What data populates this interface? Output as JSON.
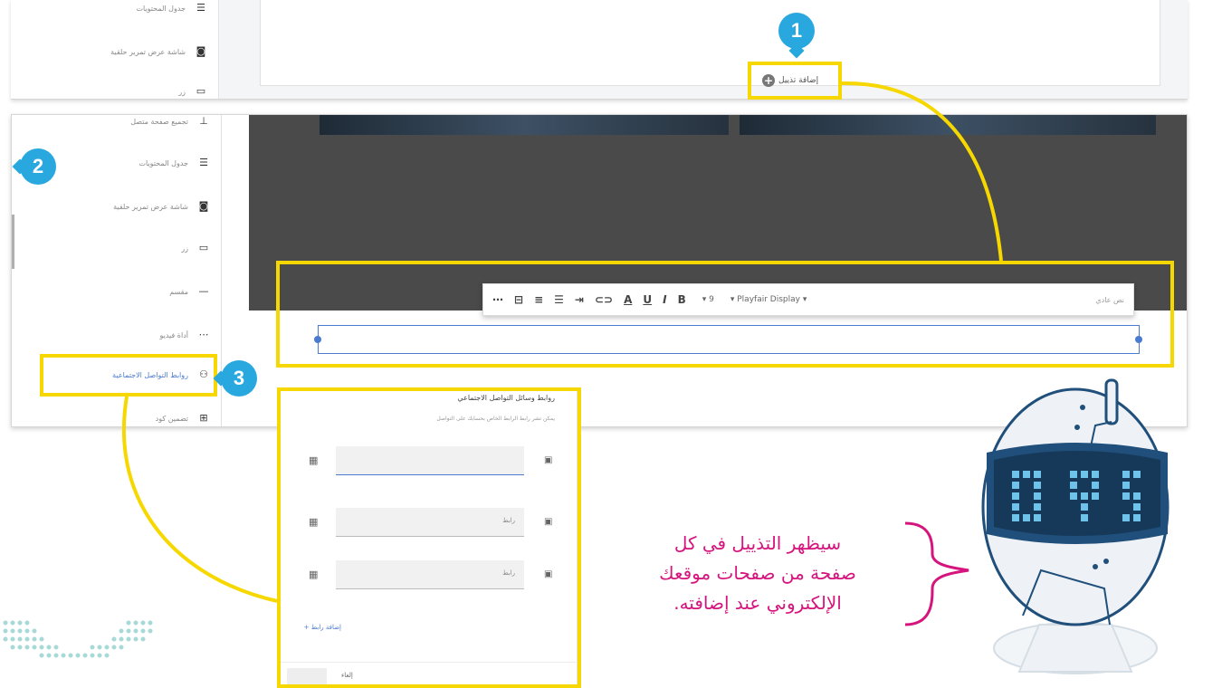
{
  "top_strip": {
    "sidebar_items": [
      "جدول المحتويات",
      "شاشة عرض تمرير حلقية",
      "زر"
    ],
    "add_footer_label": "إضافة تذييل"
  },
  "main": {
    "sidebar_items": [
      {
        "label": "تجميع صفحة متصل",
        "icon": "upload-icon"
      },
      {
        "label": "جدول المحتويات",
        "icon": "list-icon"
      },
      {
        "label": "شاشة عرض تمرير حلقية",
        "icon": "carousel-icon"
      },
      {
        "label": "زر",
        "icon": "button-icon"
      },
      {
        "label": "مقسم",
        "icon": "divider-icon"
      },
      {
        "label": "أداة فيديو",
        "icon": "dots-icon"
      },
      {
        "label": "روابط التواصل الاجتماعية",
        "icon": "social-icon"
      },
      {
        "label": "تضمين كود",
        "icon": "embed-icon"
      }
    ],
    "toolbar": {
      "style_label": "نص عادي",
      "font_label": "Playfair Display",
      "size_label": "9",
      "buttons": [
        "B",
        "I",
        "U",
        "A",
        "⊂⊃",
        "≡",
        "⋮≡",
        "≣",
        "⊟",
        "⋯"
      ]
    }
  },
  "popup": {
    "title": "روابط وسائل التواصل الاجتماعي",
    "subtitle": "يمكن نشر رابط الرابط الخاص بحسابك على التواصل",
    "rows": [
      "",
      "رابط",
      "رابط"
    ],
    "add_link": "+ إضافة رابط",
    "cancel": "إلغاء",
    "ok": ""
  },
  "badges": [
    "1",
    "2",
    "3"
  ],
  "callout_lines": [
    "سيظهر التذييل في كل",
    "صفحة من صفحات موقعك",
    "الإلكتروني عند إضافته."
  ],
  "colors": {
    "highlight": "#f6d800",
    "badge": "#29a8e0",
    "callout": "#d6147d",
    "accent": "#4a7bd1"
  }
}
